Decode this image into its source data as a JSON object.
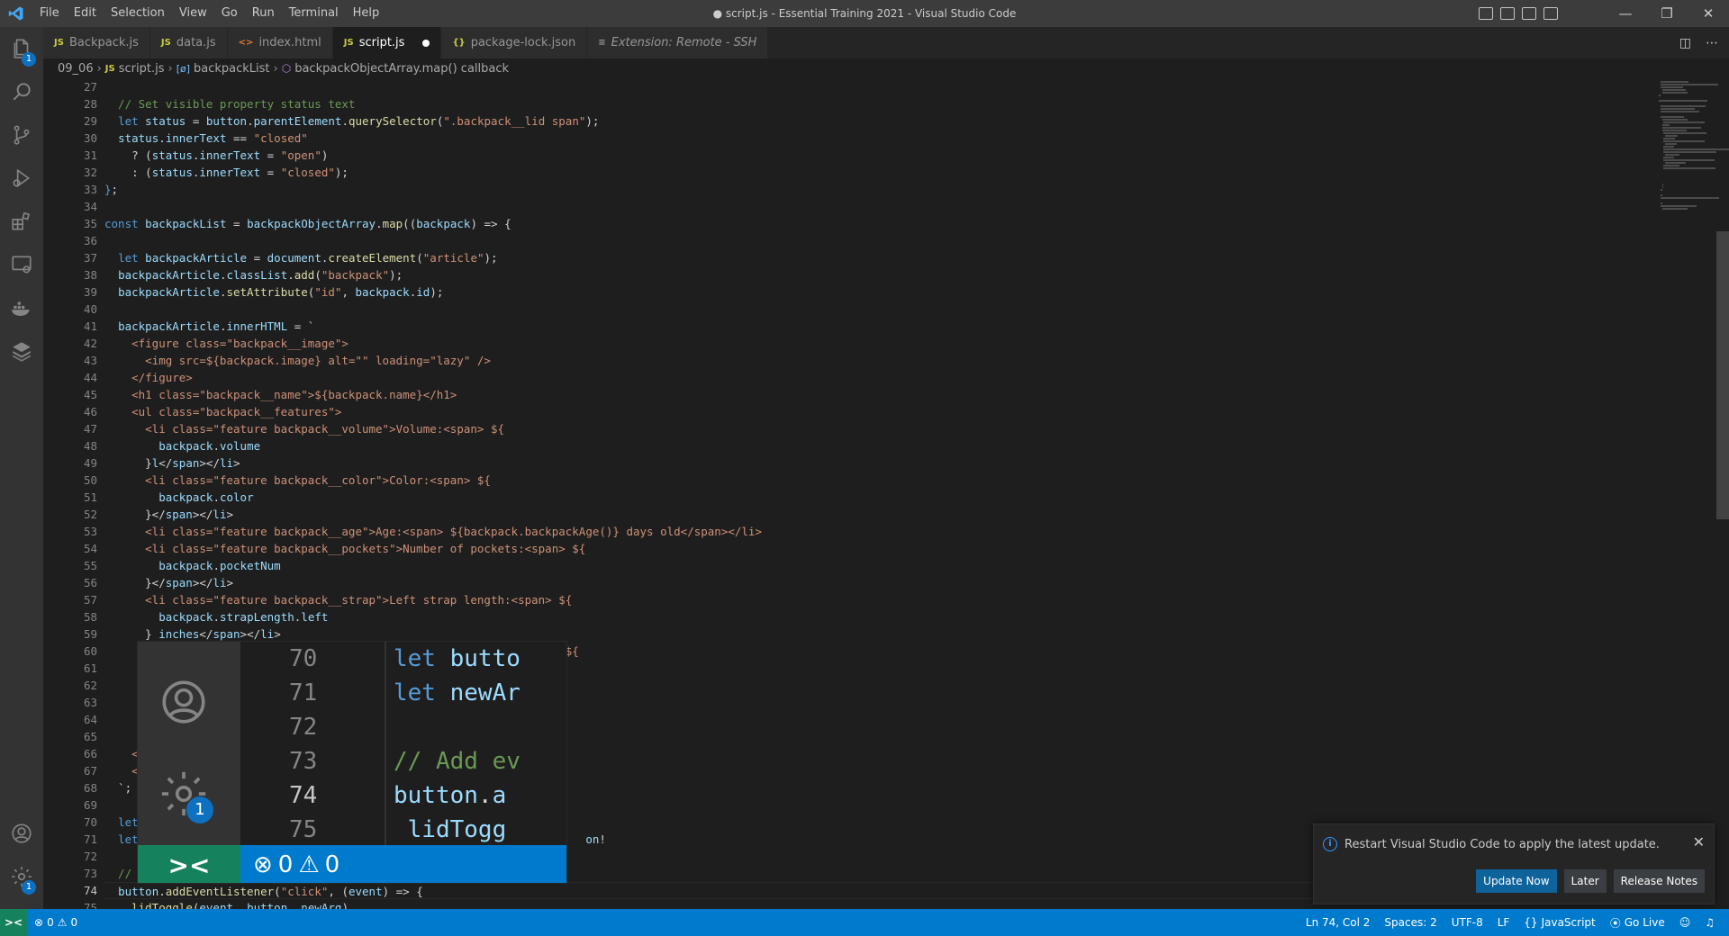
{
  "window": {
    "title": "● script.js - Essential Training 2021 - Visual Studio Code",
    "controls": [
      "—",
      "❐",
      "✕"
    ]
  },
  "menu": [
    "File",
    "Edit",
    "Selection",
    "View",
    "Go",
    "Run",
    "Terminal",
    "Help"
  ],
  "tabs": [
    {
      "icon": "JS",
      "label": "Backpack.js"
    },
    {
      "icon": "JS",
      "label": "data.js"
    },
    {
      "icon": "<>",
      "label": "index.html"
    },
    {
      "icon": "JS",
      "label": "script.js",
      "active": true,
      "dirty": true
    },
    {
      "icon": "{}",
      "label": "package-lock.json"
    },
    {
      "icon": "≡",
      "label": "Extension: Remote - SSH"
    }
  ],
  "breadcrumb": {
    "folder": "09_06",
    "file": "script.js",
    "symbol1": "backpackList",
    "symbol2": "backpackObjectArray.map() callback"
  },
  "activity_badges": {
    "explorer": "1",
    "settings": "1"
  },
  "editor": {
    "line_numbers": [
      "27",
      "28",
      "29",
      "30",
      "31",
      "32",
      "33",
      "34",
      "35",
      "36",
      "37",
      "38",
      "39",
      "40",
      "41",
      "42",
      "43",
      "44",
      "45",
      "46",
      "47",
      "48",
      "49",
      "50",
      "51",
      "52",
      "53",
      "54",
      "55",
      "56",
      "57",
      "58",
      "59",
      "60",
      "61",
      "62",
      "63",
      "64",
      "65",
      "66",
      "67",
      "68",
      "69",
      "70",
      "71",
      "72",
      "73",
      "74",
      "75"
    ],
    "current_line": "74",
    "visible_code": [
      "",
      "  // Set visible property status text",
      "  let status = button.parentElement.querySelector(\".backpack__lid span\");",
      "  status.innerText == \"closed\"",
      "    ? (status.innerText = \"open\")",
      "    : (status.innerText = \"closed\");",
      "};",
      "",
      "const backpackList = backpackObjectArray.map((backpack) => {",
      "",
      "  let backpackArticle = document.createElement(\"article\");",
      "  backpackArticle.classList.add(\"backpack\");",
      "  backpackArticle.setAttribute(\"id\", backpack.id);",
      "",
      "  backpackArticle.innerHTML = `",
      "    <figure class=\"backpack__image\">",
      "      <img src=${backpack.image} alt=\"\" loading=\"lazy\" />",
      "    </figure>",
      "    <h1 class=\"backpack__name\">${backpack.name}</h1>",
      "    <ul class=\"backpack__features\">",
      "      <li class=\"feature backpack__volume\">Volume:<span> ${",
      "        backpack.volume",
      "      }l</span></li>",
      "      <li class=\"feature backpack__color\">Color:<span> ${",
      "        backpack.color",
      "      }</span></li>",
      "      <li class=\"feature backpack__age\">Age:<span> ${backpack.backpackAge()} days old</span></li>",
      "      <li class=\"feature backpack__pockets\">Number of pockets:<span> ${",
      "        backpack.pocketNum",
      "      }</span></li>",
      "      <li class=\"feature backpack__strap\">Left strap length:<span> ${",
      "        backpack.strapLength.left",
      "      } inches</span></li>",
      "      <li class=\"feature backpack__strap\">Right strap length:<span> ${",
      "",
      "",
      "",
      "",
      "",
      "    <",
      "    <",
      "  `;",
      "",
      "  let",
      "  let                                                                  on!\"",
      "",
      "  //",
      "  button.addEventListener(\"click\", (event) => {",
      "    lidToggle(event, button, newArg)"
    ]
  },
  "zoom": {
    "line_numbers": [
      "70",
      "71",
      "72",
      "73",
      "74",
      "75"
    ],
    "code": [
      "let butto",
      "let newAr",
      "",
      "// Add ev",
      "button.a",
      " lidTogg"
    ],
    "errors": "0",
    "warnings": "0",
    "settings_badge": "1"
  },
  "statusbar": {
    "remote": "><",
    "errors": "0",
    "warnings": "0",
    "cursor": "Ln 74, Col 2",
    "spaces": "Spaces: 2",
    "encoding": "UTF-8",
    "eol": "LF",
    "language": "JavaScript",
    "golive": "Go Live"
  },
  "notification": {
    "message": "Restart Visual Studio Code to apply the latest update.",
    "buttons": [
      "Update Now",
      "Later",
      "Release Notes"
    ]
  },
  "colors": {
    "accent": "#007acc",
    "remote": "#16825d",
    "keyword": "#569cd6",
    "variable": "#9cdcfe",
    "function": "#dcdcaa",
    "string": "#ce9178",
    "comment": "#6a9955"
  }
}
